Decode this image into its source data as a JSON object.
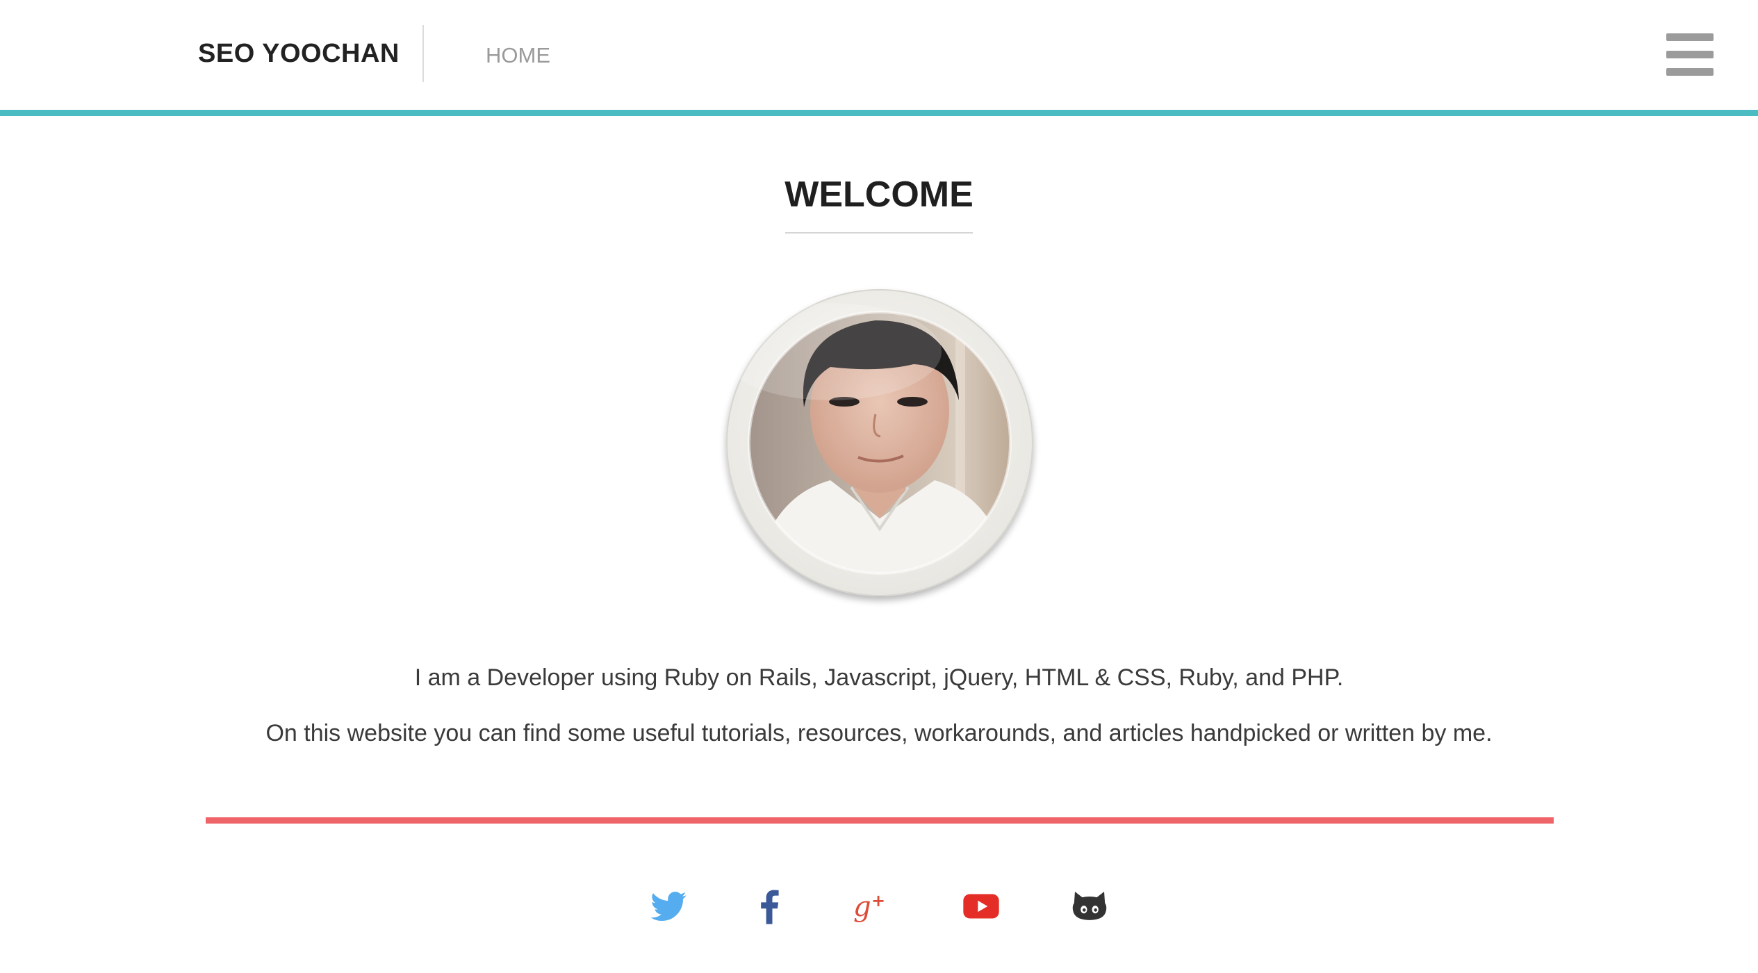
{
  "header": {
    "brand": "SEO YOOCHAN",
    "nav_home": "HOME",
    "menu_icon": "hamburger-menu-icon",
    "accent_color": "#4bbcc2"
  },
  "welcome": {
    "title": "WELCOME",
    "avatar_alt": "profile photo"
  },
  "intro": {
    "line1": "I am a Developer using Ruby on Rails, Javascript, jQuery, HTML & CSS, Ruby, and PHP.",
    "line2": "On this website you can find some useful tutorials, resources, workarounds, and articles handpicked or written by me."
  },
  "footer": {
    "rule_color": "#ef6468",
    "social": [
      {
        "icon": "twitter-icon",
        "color": "#55acee"
      },
      {
        "icon": "facebook-icon",
        "color": "#3b5998"
      },
      {
        "icon": "google-plus-icon",
        "color": "#dd4b39"
      },
      {
        "icon": "youtube-icon",
        "color": "#e52d27"
      },
      {
        "icon": "github-icon",
        "color": "#333333"
      }
    ]
  }
}
